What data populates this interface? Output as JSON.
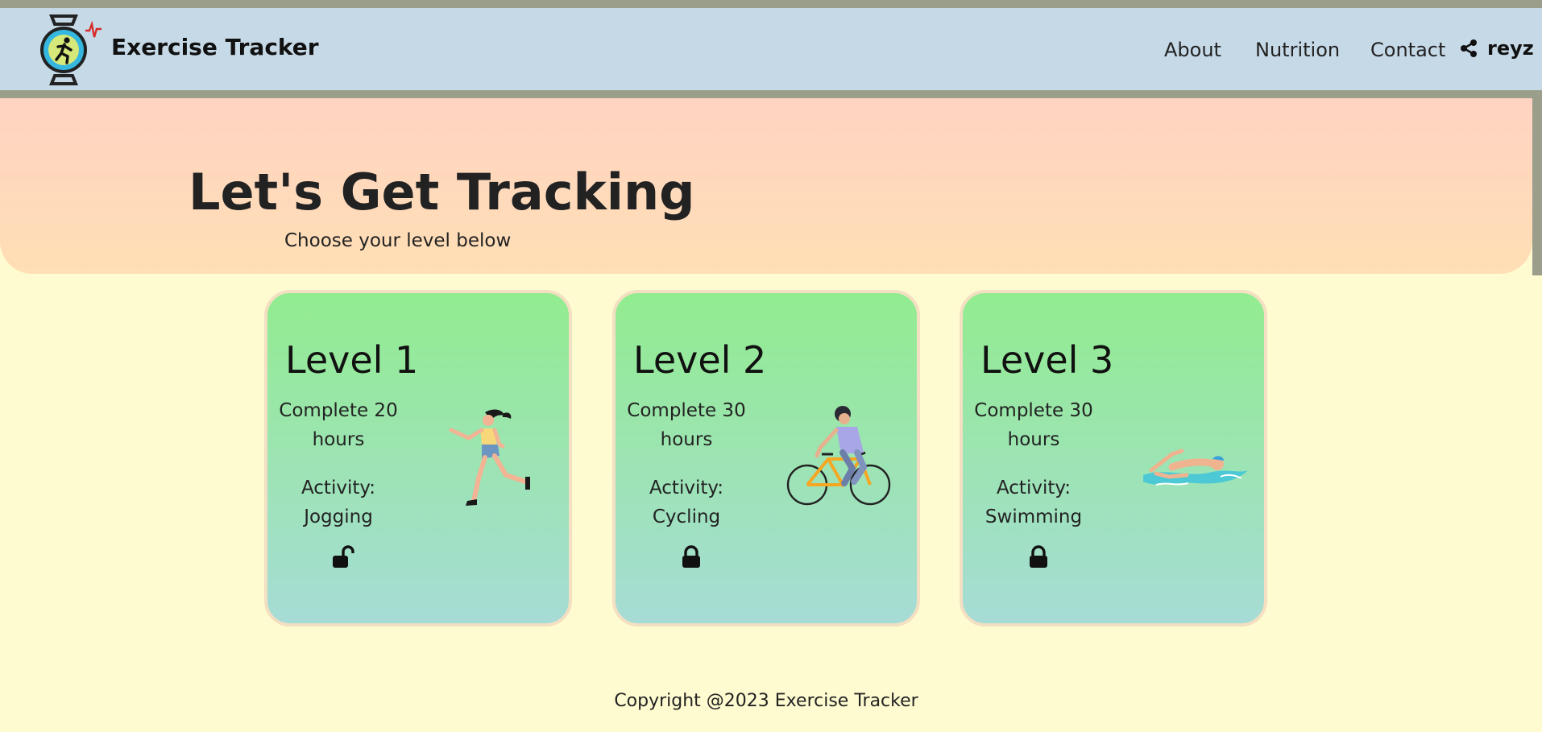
{
  "header": {
    "brand": "Exercise Tracker",
    "nav": [
      "About",
      "Nutrition",
      "Contact"
    ],
    "user": "reyz"
  },
  "hero": {
    "title": "Let's Get Tracking",
    "subtitle": "Choose your level below"
  },
  "levels": [
    {
      "title": "Level 1",
      "goal_line1": "Complete 20",
      "goal_line2": "hours",
      "activity_label": "Activity:",
      "activity": "Jogging",
      "lock": "unlocked",
      "illustration": "jogger-icon"
    },
    {
      "title": "Level 2",
      "goal_line1": "Complete 30",
      "goal_line2": "hours",
      "activity_label": "Activity:",
      "activity": "Cycling",
      "lock": "locked",
      "illustration": "cyclist-icon"
    },
    {
      "title": "Level 3",
      "goal_line1": "Complete 30",
      "goal_line2": "hours",
      "activity_label": "Activity:",
      "activity": "Swimming",
      "lock": "locked",
      "illustration": "swimmer-icon"
    }
  ],
  "footer": {
    "text": "Copyright @2023 Exercise Tracker"
  },
  "colors": {
    "nav_bg": "#c6d9e7",
    "page_bg": "#fffbd0",
    "hero_top": "#ffd3c2",
    "hero_bottom": "#ffdfb5",
    "card_top": "#92ec8f",
    "card_bottom": "#a6dcd6"
  }
}
